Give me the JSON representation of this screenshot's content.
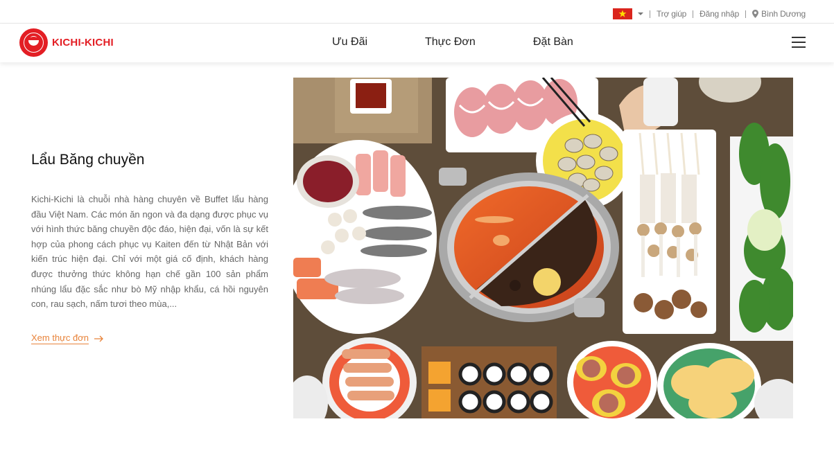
{
  "topbar": {
    "flag_icon": "vietnam-flag-icon",
    "help": "Trợ giúp",
    "login": "Đăng nhập",
    "location": "Bình Dương"
  },
  "header": {
    "logo_text": "KICHI-KICHI",
    "brand_color": "#e31e24",
    "nav": [
      "Ưu Đãi",
      "Thực Đơn",
      "Đặt Bàn"
    ],
    "menu_icon": "hamburger-icon"
  },
  "content": {
    "title": "Lẩu Băng chuyền",
    "description": "Kichi-Kichi là chuỗi nhà hàng chuyên về Buffet lẩu hàng đầu Việt Nam. Các món ăn ngon và đa dạng được phục vụ với hình thức băng chuyền độc đáo, hiện đại, vốn là sự kết hợp của phong cách phục vụ Kaiten đến từ Nhật Bản với kiến trúc hiện đại. Chỉ với một giá cố định, khách hàng được thưởng thức không hạn chế gần 100 sản phẩm nhúng lẩu đặc sắc như bò Mỹ nhập khẩu, cá hồi nguyên con, rau sạch, nấm tươi theo mùa,...",
    "link_label": "Xem thực đơn",
    "link_color": "#e8833a"
  }
}
